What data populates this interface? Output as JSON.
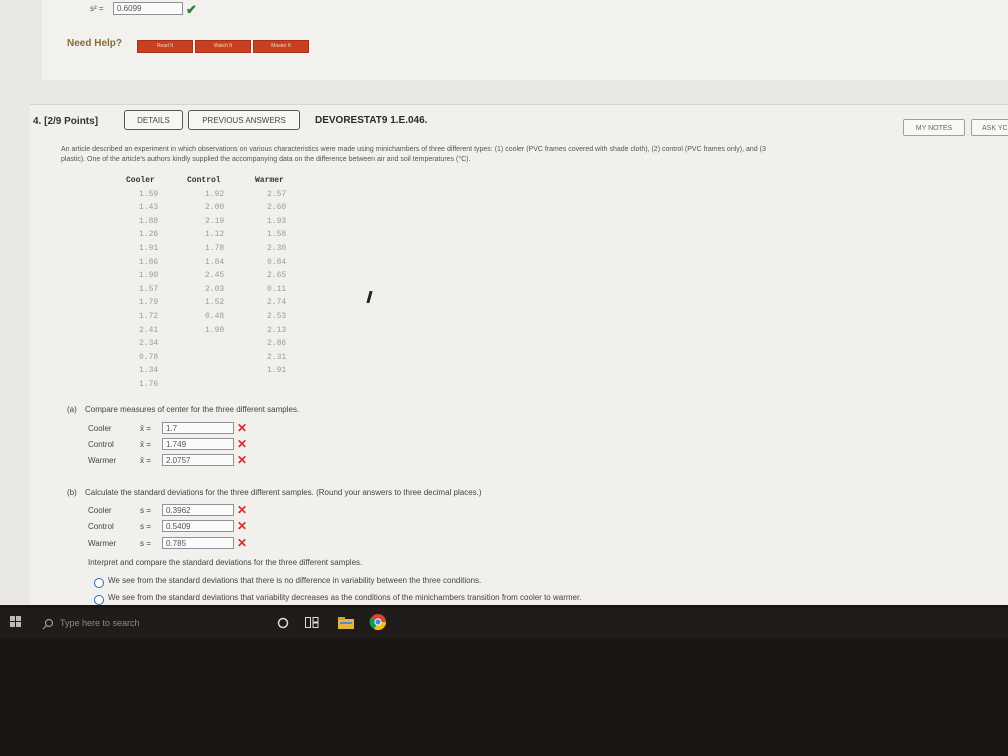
{
  "top": {
    "s2_label": "s² =",
    "s2_value": "0.6099",
    "need_help": "Need Help?",
    "help_buttons": [
      "Read It",
      "Watch It",
      "Master It"
    ]
  },
  "question": {
    "number": "4.",
    "points": "[2/9 Points]",
    "details_label": "DETAILS",
    "previous_answers_label": "PREVIOUS ANSWERS",
    "id": "DEVORESTAT9 1.E.046.",
    "my_notes_label": "MY NOTES",
    "ask_label": "ASK YC",
    "description_line1": "An article described an experiment in which observations on various characteristics were made using minichambers of three different types: (1) cooler (PVC frames covered with shade cloth), (2) control (PVC frames only), and (3",
    "description_line2": "plastic). One of the article's authors kindly supplied the accompanying data on the difference between air and soil temperatures (°C)."
  },
  "table": {
    "headers": [
      "Cooler",
      "Control",
      "Warmer"
    ],
    "cooler": [
      "1.59",
      "1.43",
      "1.88",
      "1.26",
      "1.91",
      "1.86",
      "1.90",
      "1.57",
      "1.79",
      "1.72",
      "2.41",
      "2.34",
      "0.78",
      "1.34",
      "1.76"
    ],
    "control": [
      "1.92",
      "2.00",
      "2.19",
      "1.12",
      "1.78",
      "1.84",
      "2.45",
      "2.03",
      "1.52",
      "0.48",
      "1.90"
    ],
    "warmer": [
      "2.57",
      "2.60",
      "1.93",
      "1.58",
      "2.30",
      "0.84",
      "2.65",
      "0.11",
      "2.74",
      "2.53",
      "2.13",
      "2.86",
      "2.31",
      "1.91"
    ]
  },
  "part_a": {
    "label": "(a)",
    "prompt": "Compare measures of center for the three different samples.",
    "rows": [
      {
        "name": "Cooler",
        "symbol": "x̄ =",
        "value": "1.7",
        "mark": "✕"
      },
      {
        "name": "Control",
        "symbol": "x̄ =",
        "value": "1.749",
        "mark": "✕"
      },
      {
        "name": "Warmer",
        "symbol": "x̄ =",
        "value": "2.0757",
        "mark": "✕"
      }
    ]
  },
  "part_b": {
    "label": "(b)",
    "prompt": "Calculate the standard deviations for the three different samples. (Round your answers to three decimal places.)",
    "rows": [
      {
        "name": "Cooler",
        "symbol": "s =",
        "value": "0.3962",
        "mark": "✕"
      },
      {
        "name": "Control",
        "symbol": "s =",
        "value": "0.5409",
        "mark": "✕"
      },
      {
        "name": "Warmer",
        "symbol": "s =",
        "value": "0.785",
        "mark": "✕"
      }
    ],
    "interpret_prompt": "Interpret and compare the standard deviations for the three different samples.",
    "option1": "We see from the standard deviations that there is no difference in variability between the three conditions.",
    "option2": "We see from the standard deviations that variability decreases as the conditions of the minichambers transition from cooler to warmer."
  },
  "taskbar": {
    "search_placeholder": "Type here to search"
  }
}
